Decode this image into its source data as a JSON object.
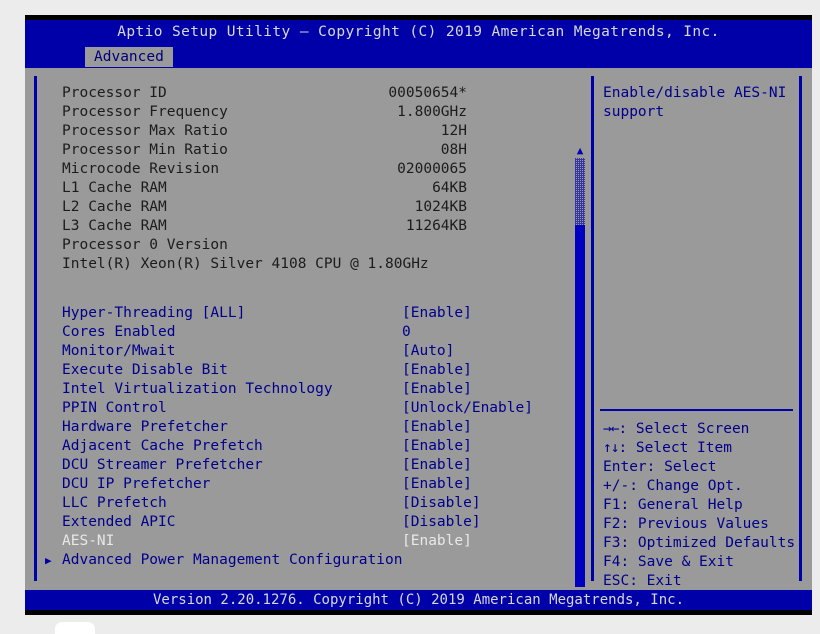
{
  "window": {
    "title": "Aptio Setup Utility – Copyright (C) 2019 American Megatrends, Inc.",
    "footer": "Version 2.20.1276. Copyright (C) 2019 American Megatrends, Inc."
  },
  "menu": {
    "tabs": [
      {
        "label": "Advanced",
        "active": true
      }
    ]
  },
  "colors": {
    "bar_blue": "#0000a8",
    "panel_gray": "#9a9a9a",
    "label_blue": "#00008c",
    "info_black": "#1c1c1c",
    "selected_white": "#e8e8e8"
  },
  "main": {
    "info_rows": [
      {
        "label": "Processor ID",
        "value": "00050654*"
      },
      {
        "label": "Processor Frequency",
        "value": "1.800GHz"
      },
      {
        "label": "Processor Max Ratio",
        "value": "12H"
      },
      {
        "label": "Processor Min Ratio",
        "value": "08H"
      },
      {
        "label": "Microcode Revision",
        "value": "02000065"
      },
      {
        "label": "L1 Cache RAM",
        "value": "64KB"
      },
      {
        "label": "L2 Cache RAM",
        "value": "1024KB"
      },
      {
        "label": "L3 Cache RAM",
        "value": "11264KB"
      },
      {
        "label": "Processor 0 Version",
        "value": ""
      }
    ],
    "processor_version": "Intel(R) Xeon(R) Silver 4108 CPU @ 1.80GHz",
    "setting_rows": [
      {
        "label": "Hyper-Threading [ALL]",
        "value": "[Enable]",
        "selected": false,
        "submenu": false
      },
      {
        "label": "Cores Enabled",
        "value": "0",
        "selected": false,
        "submenu": false
      },
      {
        "label": "Monitor/Mwait",
        "value": "[Auto]",
        "selected": false,
        "submenu": false
      },
      {
        "label": "Execute Disable Bit",
        "value": "[Enable]",
        "selected": false,
        "submenu": false
      },
      {
        "label": "Intel Virtualization Technology",
        "value": "[Enable]",
        "selected": false,
        "submenu": false
      },
      {
        "label": "PPIN Control",
        "value": "[Unlock/Enable]",
        "selected": false,
        "submenu": false
      },
      {
        "label": "Hardware Prefetcher",
        "value": "[Enable]",
        "selected": false,
        "submenu": false
      },
      {
        "label": "Adjacent Cache Prefetch",
        "value": "[Enable]",
        "selected": false,
        "submenu": false
      },
      {
        "label": "DCU Streamer Prefetcher",
        "value": "[Enable]",
        "selected": false,
        "submenu": false
      },
      {
        "label": "DCU IP Prefetcher",
        "value": "[Enable]",
        "selected": false,
        "submenu": false
      },
      {
        "label": "LLC Prefetch",
        "value": "[Disable]",
        "selected": false,
        "submenu": false
      },
      {
        "label": "Extended APIC",
        "value": "[Disable]",
        "selected": false,
        "submenu": false
      },
      {
        "label": "AES-NI",
        "value": "[Enable]",
        "selected": true,
        "submenu": false
      },
      {
        "label": "Advanced Power Management Configuration",
        "value": "",
        "selected": false,
        "submenu": true
      }
    ]
  },
  "scrollbar": {
    "up_arrow": "▲",
    "down_arrow": "▼"
  },
  "help": {
    "text": "Enable/disable AES-NI support",
    "keys": [
      {
        "glyph": "→←",
        "text": ": Select Screen"
      },
      {
        "glyph": "↑↓",
        "text": ": Select Item"
      },
      {
        "glyph": "",
        "text": "Enter: Select"
      },
      {
        "glyph": "",
        "text": "+/-: Change Opt."
      },
      {
        "glyph": "",
        "text": "F1: General Help"
      },
      {
        "glyph": "",
        "text": "F2: Previous Values"
      },
      {
        "glyph": "",
        "text": "F3: Optimized Defaults"
      },
      {
        "glyph": "",
        "text": "F4: Save & Exit"
      },
      {
        "glyph": "",
        "text": "ESC: Exit"
      }
    ]
  }
}
